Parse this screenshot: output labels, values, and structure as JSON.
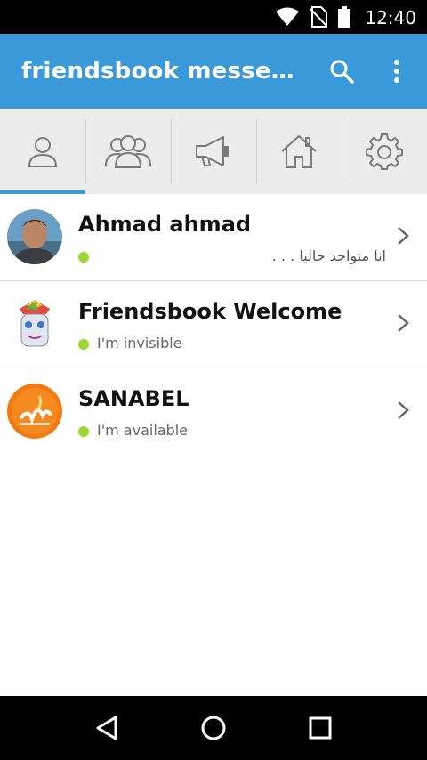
{
  "status_bar": {
    "time": "12:40",
    "icons": [
      "wifi-icon",
      "no-sim-icon",
      "battery-icon"
    ]
  },
  "app_bar": {
    "title": "friendsbook messeng…",
    "actions": [
      "search-icon",
      "more-vert-icon"
    ],
    "color": "#3a9ad9"
  },
  "tabs": [
    {
      "icon": "contact-person-icon",
      "selected": true
    },
    {
      "icon": "group-icon",
      "selected": false
    },
    {
      "icon": "megaphone-icon",
      "selected": false
    },
    {
      "icon": "home-icon",
      "selected": false
    },
    {
      "icon": "gear-icon",
      "selected": false
    }
  ],
  "contacts": [
    {
      "name": "Ahmad ahmad",
      "status": "انا متواجد حاليا . . .",
      "online_color": "#9ad92f"
    },
    {
      "name": "Friendsbook Welcome",
      "status": "I'm invisible",
      "online_color": "#9ad92f"
    },
    {
      "name": "SANABEL",
      "status": "I'm available",
      "online_color": "#9ad92f"
    }
  ],
  "nav_bar": [
    "back-icon",
    "home-circle-icon",
    "recents-icon"
  ]
}
